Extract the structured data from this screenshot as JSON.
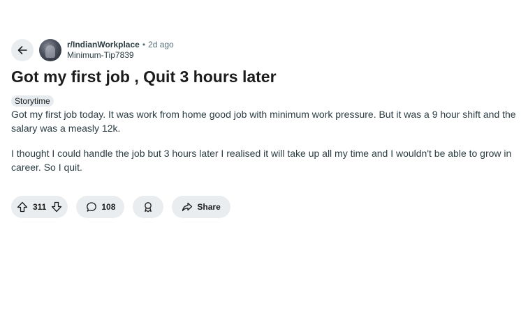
{
  "post": {
    "subreddit": "r/IndianWorkplace",
    "separator": "•",
    "time_ago": "2d ago",
    "author": "Minimum-Tip7839",
    "title": "Got my first job , Quit 3 hours later",
    "flair": "Storytime",
    "body": [
      "Got my first job today. It was work from home good job with minimum work pressure. But it was a 9 hour shift and the salary was a measly 12k.",
      "I thought I could handle the job but 3 hours later I realised it will take up all my time and I wouldn't be able to grow in career. So I quit."
    ]
  },
  "actions": {
    "score": "311",
    "comments": "108",
    "share_label": "Share"
  },
  "icons": {
    "back": "back-arrow-icon",
    "upvote": "upvote-arrow-icon",
    "downvote": "downvote-arrow-icon",
    "comment": "comment-bubble-icon",
    "award": "award-ribbon-icon",
    "share": "share-arrow-icon"
  },
  "colors": {
    "pill_background": "#eaedef",
    "text_primary": "#1c1c1c",
    "text_secondary": "#576f76",
    "flair_background": "#e5ebee"
  }
}
